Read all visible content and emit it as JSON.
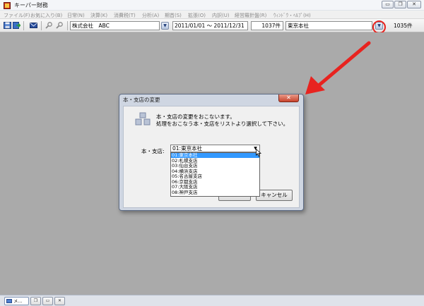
{
  "window": {
    "title": "キーパー財務",
    "minimize_glyph": "▭",
    "maximize_glyph": "❐",
    "close_glyph": "✕"
  },
  "menu": [
    "ファイル(F)",
    "お気に入り(B)",
    "日常(N)",
    "決算(K)",
    "消費税(T)",
    "分析(A)",
    "期首(S)",
    "拡張(O)",
    "内訳(U)",
    "経営羅針盤(R)",
    "ｳｨﾝﾄﾞｳ・ﾍﾙﾌﾟ(H)"
  ],
  "toolbar": {
    "icons": [
      "save-icon",
      "import-icon",
      "mail-icon",
      "search-icon",
      "search-alt-icon"
    ],
    "company": "株式会社　ABC",
    "period": "2011/01/01 〜 2011/12/31",
    "period_count": "1037件",
    "branch": "東京本社",
    "branch_count": "1035件"
  },
  "dialog": {
    "title": "本・支店の変更",
    "close_glyph": "✕",
    "message_line1": "本・支店の変更をおこないます。",
    "message_line2": "処理をおこなう本・支店をリストより選択して下さい。",
    "field_label": "本・支店:",
    "selected_value": "01:東京本社",
    "options": [
      "01:東京本社",
      "02:札幌支店",
      "03:仙台支店",
      "04:横浜支店",
      "05:名古屋支店",
      "06:京都支店",
      "07:大阪支店",
      "08:神戸支店"
    ],
    "ok_label": "OK",
    "cancel_label": "キャンセル"
  },
  "taskbar": {
    "tab_label": "メ...",
    "restore_glyph": "❐",
    "max_glyph": "▭",
    "close_glyph": "✕"
  },
  "colors": {
    "workspace": "#aaaaaa",
    "selection": "#3399ff",
    "annotation_red": "#e8231f",
    "close_button": "#c9432c"
  }
}
